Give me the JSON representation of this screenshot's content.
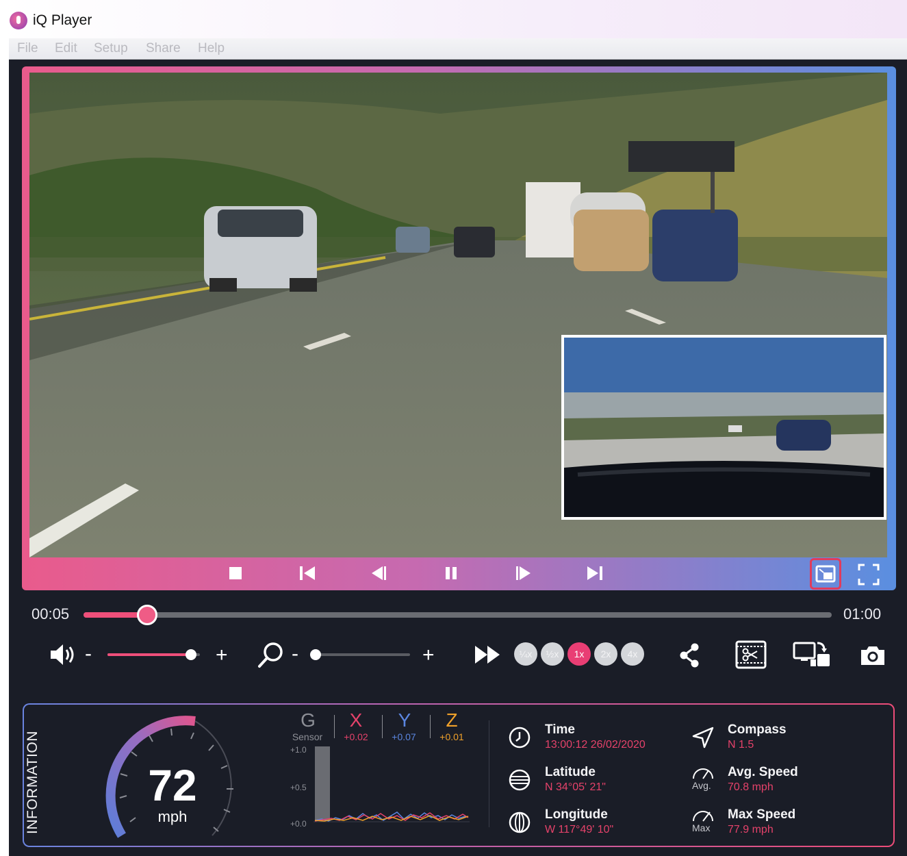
{
  "window": {
    "title": "iQ Player"
  },
  "menu": [
    "File",
    "Edit",
    "Setup",
    "Share",
    "Help"
  ],
  "playback": {
    "current_time": "00:05",
    "total_time": "01:00",
    "progress": 0.085,
    "volume_minus": "-",
    "volume_plus": "+",
    "volume_level": 0.9,
    "zoom_minus": "-",
    "zoom_plus": "+",
    "zoom_level": 0.0,
    "speeds": [
      "¼x",
      "½x",
      "1x",
      "2x",
      "4x"
    ],
    "active_speed": "1x"
  },
  "icons": {
    "controls": [
      "stop-icon",
      "skip-back-icon",
      "step-back-icon",
      "pause-icon",
      "step-forward-icon",
      "skip-forward-icon"
    ],
    "view": [
      "picture-in-picture-icon",
      "fullscreen-icon"
    ],
    "tools": [
      "share-icon",
      "trim-video-icon",
      "switch-camera-icon",
      "camera-icon"
    ]
  },
  "colors": {
    "accent": "#e93e74",
    "panel_bg": "#1a1d27",
    "axis_x": "#e5426a",
    "axis_y": "#5b86e0",
    "axis_z": "#f0a12a"
  },
  "information": {
    "title": "INFORMATION",
    "speed": {
      "value": "72",
      "unit": "mph"
    },
    "gsensor": {
      "label": "G",
      "sublabel": "Sensor",
      "axes": [
        {
          "name": "X",
          "value": "+0.02"
        },
        {
          "name": "Y",
          "value": "+0.07"
        },
        {
          "name": "Z",
          "value": "+0.01"
        }
      ],
      "ticks": [
        "+1.0",
        "+0.5",
        "+0.0"
      ]
    },
    "time": {
      "label": "Time",
      "value": "13:00:12  26/02/2020"
    },
    "latitude": {
      "label": "Latitude",
      "value": "N 34°05' 21\""
    },
    "longitude": {
      "label": "Longitude",
      "value": "W 117°49' 10\""
    },
    "compass": {
      "label": "Compass",
      "value": "N   1.5"
    },
    "avg_speed": {
      "label": "Avg. Speed",
      "value": "70.8 mph",
      "icon_sub": "Avg."
    },
    "max_speed": {
      "label": "Max Speed",
      "value": "77.9 mph",
      "icon_sub": "Max"
    }
  }
}
